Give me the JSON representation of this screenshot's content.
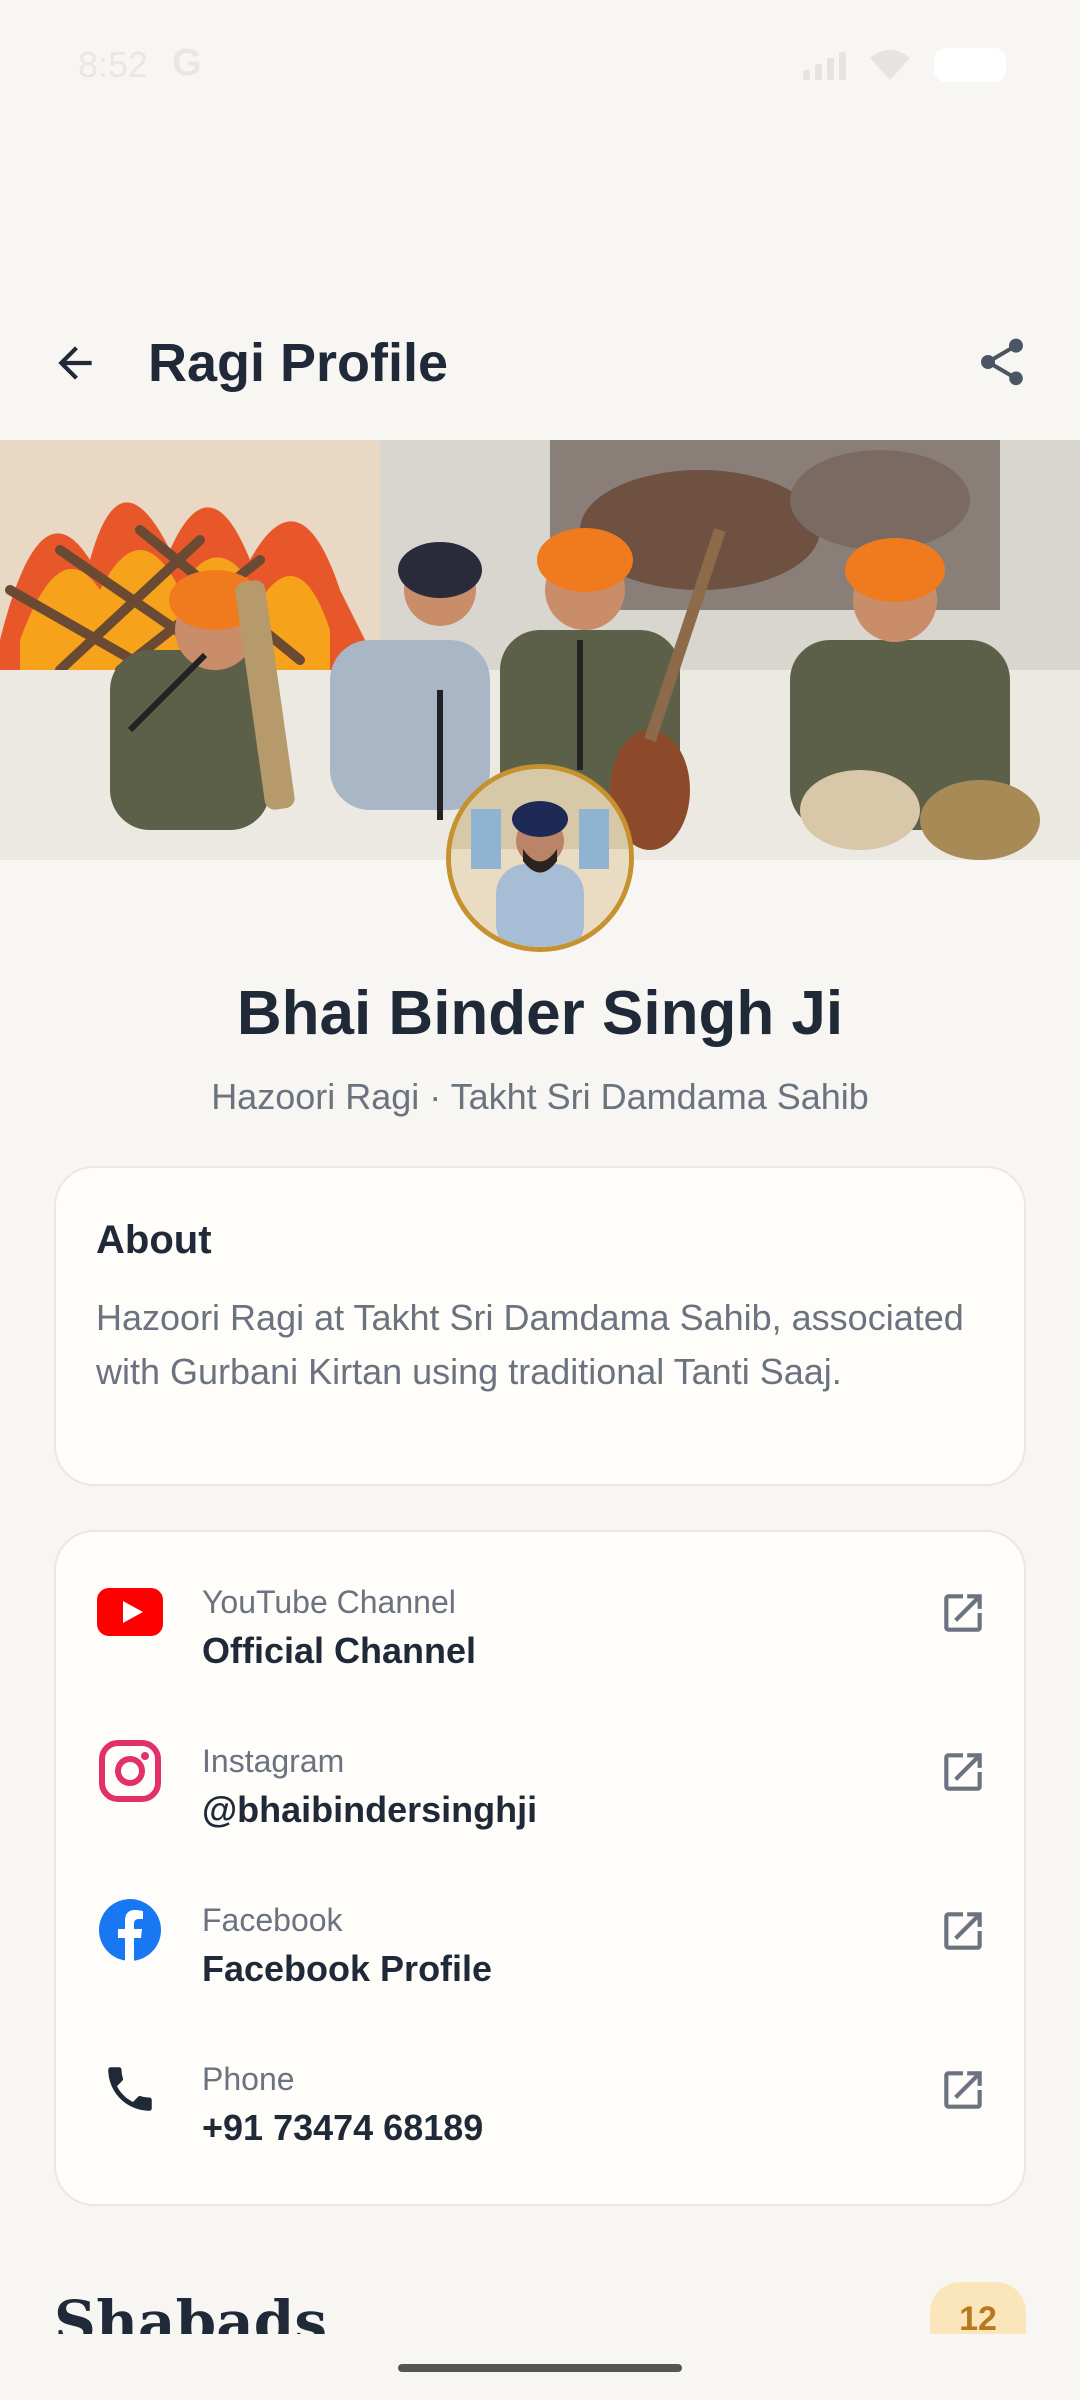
{
  "status_bar": {
    "time": "8:52",
    "g_label": "G"
  },
  "app_bar": {
    "title": "Ragi Profile"
  },
  "profile": {
    "name": "Bhai Binder Singh Ji",
    "subtitle": "Hazoori Ragi · Takht Sri Damdama Sahib"
  },
  "about": {
    "title": "About",
    "text": "Hazoori Ragi at Takht Sri Damdama Sahib, associated with Gurbani Kirtan using traditional Tanti Saaj."
  },
  "links": [
    {
      "label": "YouTube Channel",
      "value": "Official Channel",
      "icon": "youtube-icon",
      "color": "#ff0000"
    },
    {
      "label": "Instagram",
      "value": "@bhaibindersinghji",
      "icon": "instagram-icon",
      "color": "#e1306c"
    },
    {
      "label": "Facebook",
      "value": "Facebook Profile",
      "icon": "facebook-icon",
      "color": "#1877f2"
    },
    {
      "label": "Phone",
      "value": "+91 73474 68189",
      "icon": "phone-icon",
      "color": "#1f2937"
    }
  ],
  "shabads": {
    "title": "Shabads",
    "count": "12"
  },
  "colors": {
    "accent": "#c5922f",
    "background": "#f8f6f3",
    "badge": "#fbe6bc"
  }
}
